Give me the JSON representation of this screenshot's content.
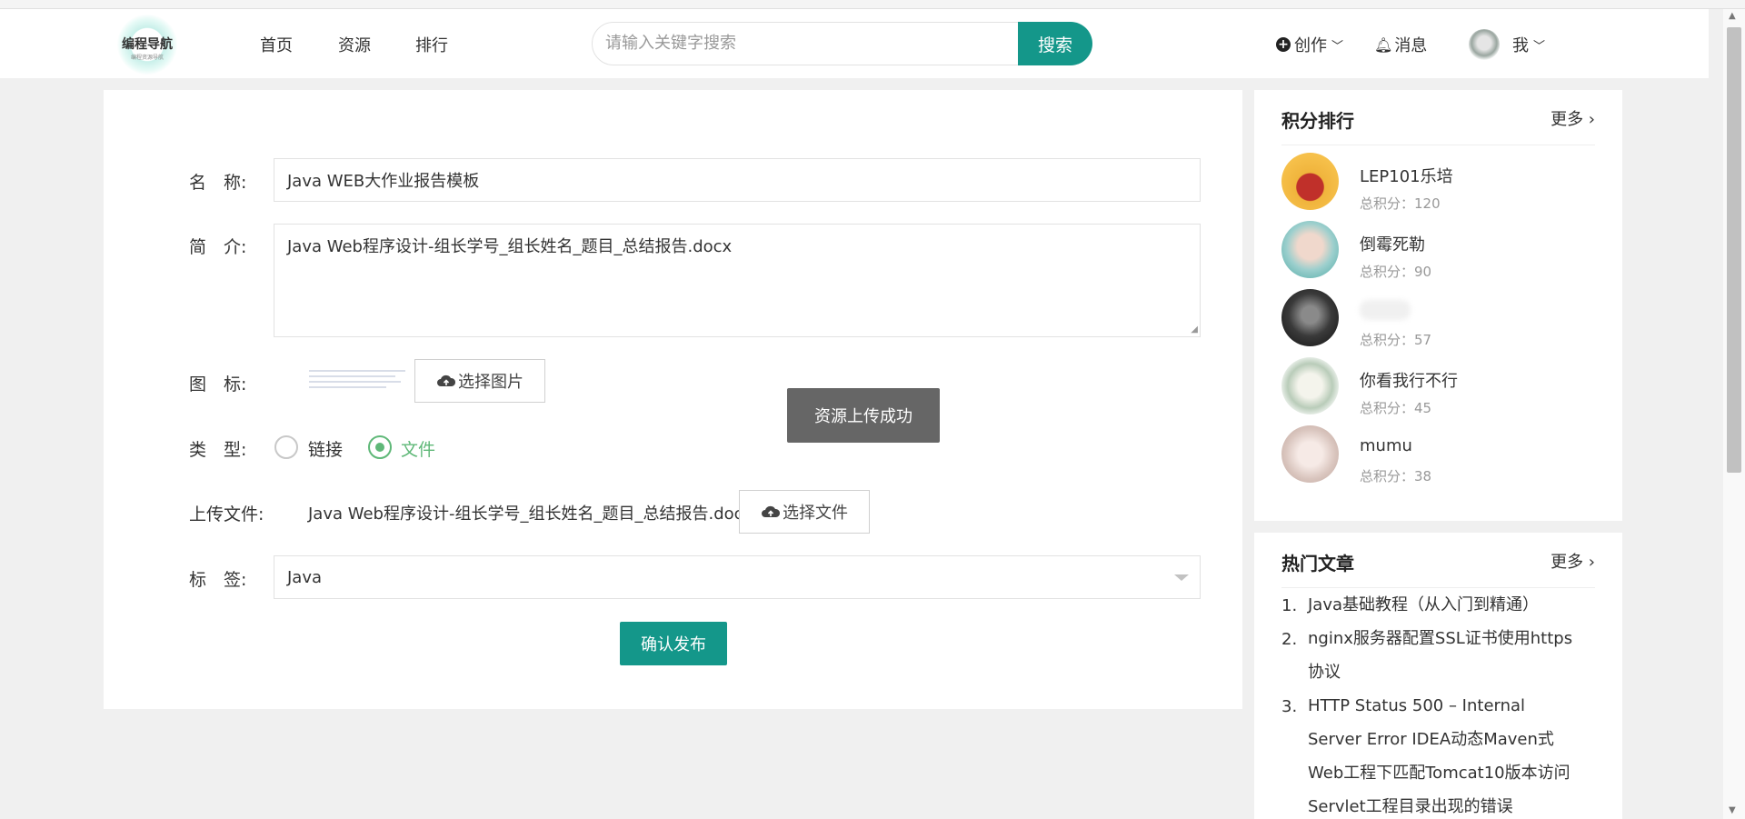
{
  "header": {
    "logo_main": "编程导航",
    "logo_sub": "编程资源导航",
    "nav": [
      "首页",
      "资源",
      "排行"
    ],
    "search_placeholder": "请输入关键字搜索",
    "search_button": "搜索",
    "create_label": "创作",
    "message_label": "消息",
    "me_label": "我"
  },
  "form": {
    "name_label": "名　称:",
    "name_value": "Java WEB大作业报告模板",
    "intro_label": "简　介:",
    "intro_value": "Java Web程序设计-组长学号_组长姓名_题目_总结报告.docx",
    "icon_label": "图　标:",
    "choose_image": "选择图片",
    "type_label": "类　型:",
    "type_options": [
      "链接",
      "文件"
    ],
    "type_selected": "文件",
    "upload_label": "上传文件:",
    "upload_filename": "Java Web程序设计-组长学号_组长姓名_题目_总结报告.docx",
    "choose_file": "选择文件",
    "tag_label": "标　签:",
    "tag_value": "Java",
    "submit": "确认发布"
  },
  "toast": "资源上传成功",
  "ranking": {
    "title": "积分排行",
    "more": "更多",
    "items": [
      {
        "name": "LEP101乐培",
        "score": "总积分：120"
      },
      {
        "name": "倒霉死勒",
        "score": "总积分：90"
      },
      {
        "name": "",
        "score": "总积分：57"
      },
      {
        "name": "你看我行不行",
        "score": "总积分：45"
      },
      {
        "name": "mumu",
        "score": "总积分：38"
      }
    ]
  },
  "hot_articles": {
    "title": "热门文章",
    "more": "更多",
    "items": [
      {
        "num": "1.",
        "title": "Java基础教程（从入门到精通）"
      },
      {
        "num": "2.",
        "title": "nginx服务器配置SSL证书使用https协议"
      },
      {
        "num": "3.",
        "title": "HTTP Status 500 – Internal Server Error IDEA动态Maven式Web工程下匹配Tomcat10版本访问Servlet工程目录出现的错误"
      }
    ]
  },
  "colors": {
    "accent": "#14978a",
    "radio_green": "#5fb878",
    "toast_bg": "#666666"
  }
}
